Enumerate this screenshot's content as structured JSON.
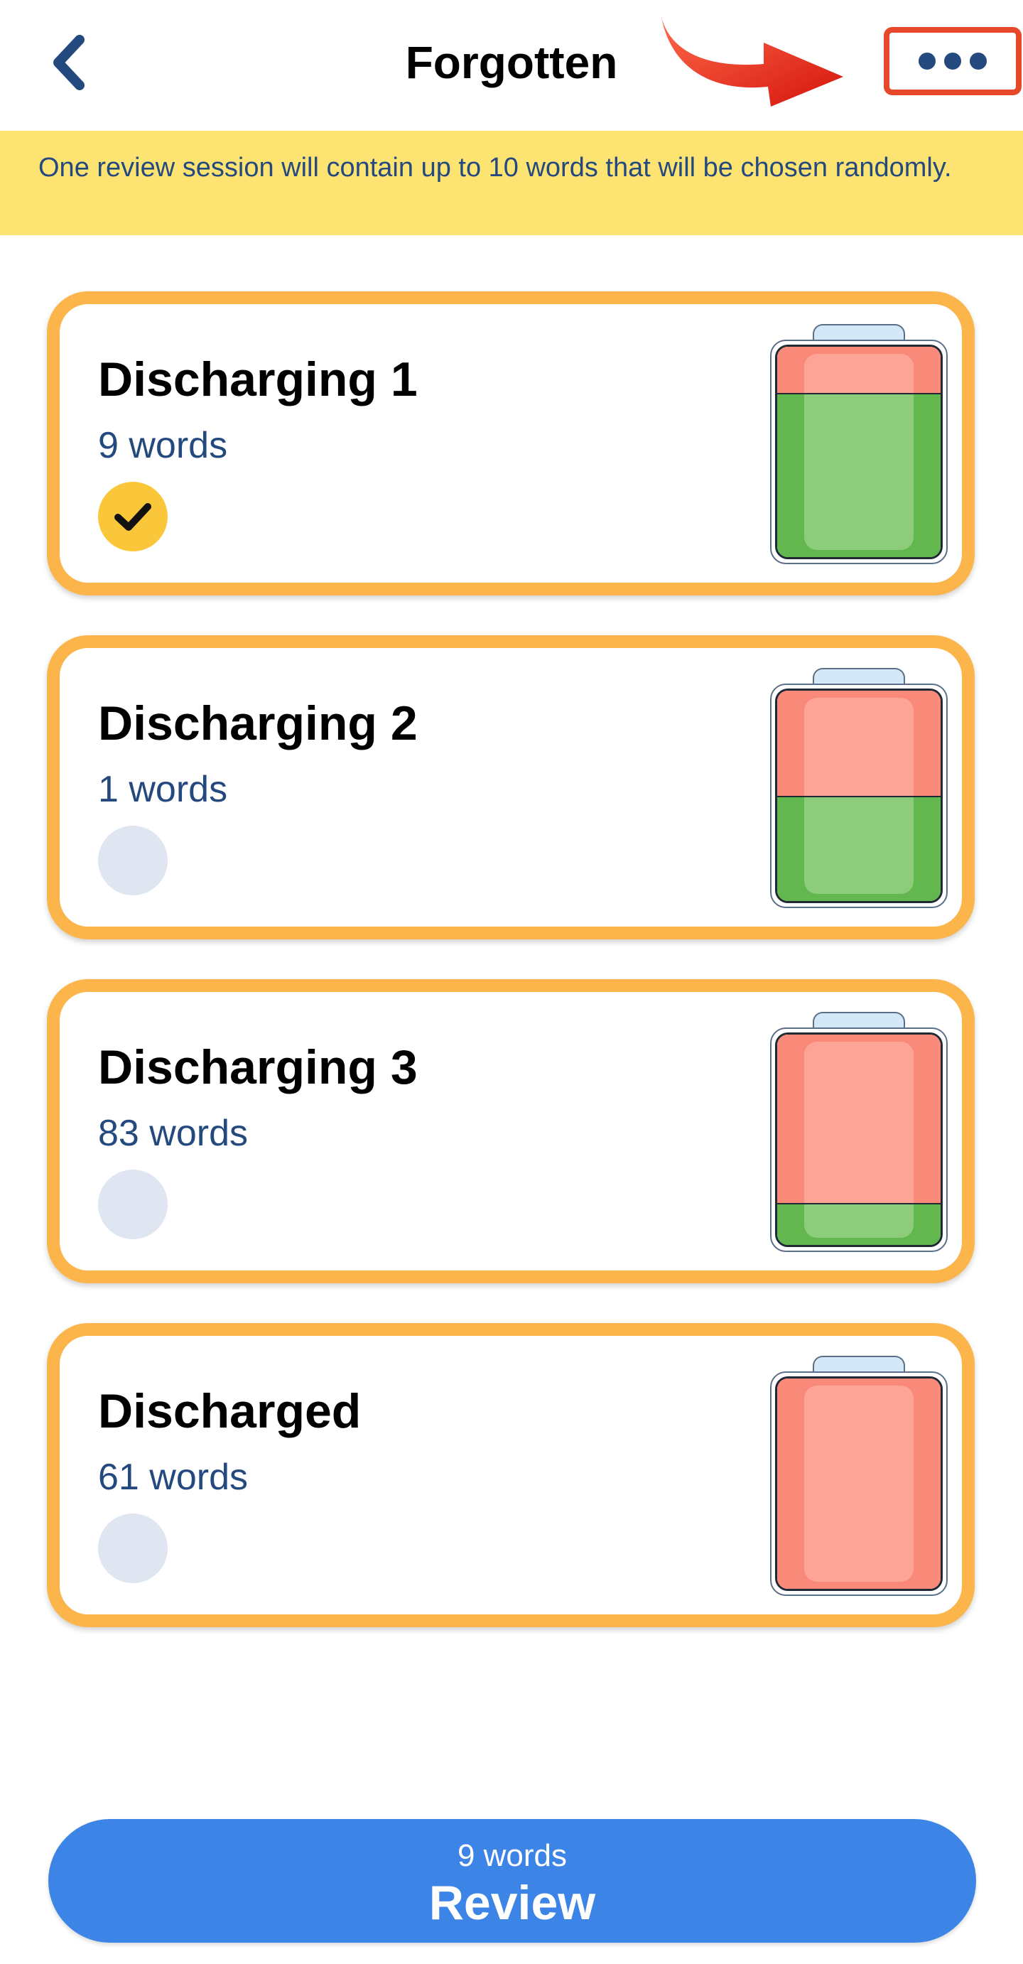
{
  "header": {
    "title": "Forgotten",
    "back_icon": "chevron-left-icon",
    "more_icon": "more-horizontal-icon",
    "annotation_arrow_icon": "red-curved-arrow-icon"
  },
  "banner": {
    "text": "One review session will contain up to 10 words that will be chosen randomly."
  },
  "colors": {
    "accent_orange": "#fbb54a",
    "banner_yellow": "#fde372",
    "text_blue": "#24497e",
    "button_blue": "#3d84e7",
    "battery_red": "#f98a7a",
    "battery_green": "#62b74f",
    "highlight_red": "#e8482a"
  },
  "groups": [
    {
      "title": "Discharging 1",
      "count": "9 words",
      "selected": true,
      "charge_fraction": 0.78
    },
    {
      "title": "Discharging 2",
      "count": "1 words",
      "selected": false,
      "charge_fraction": 0.5
    },
    {
      "title": "Discharging 3",
      "count": "83 words",
      "selected": false,
      "charge_fraction": 0.2
    },
    {
      "title": "Discharged",
      "count": "61 words",
      "selected": false,
      "charge_fraction": 0
    }
  ],
  "review": {
    "count": "9 words",
    "label": "Review"
  }
}
